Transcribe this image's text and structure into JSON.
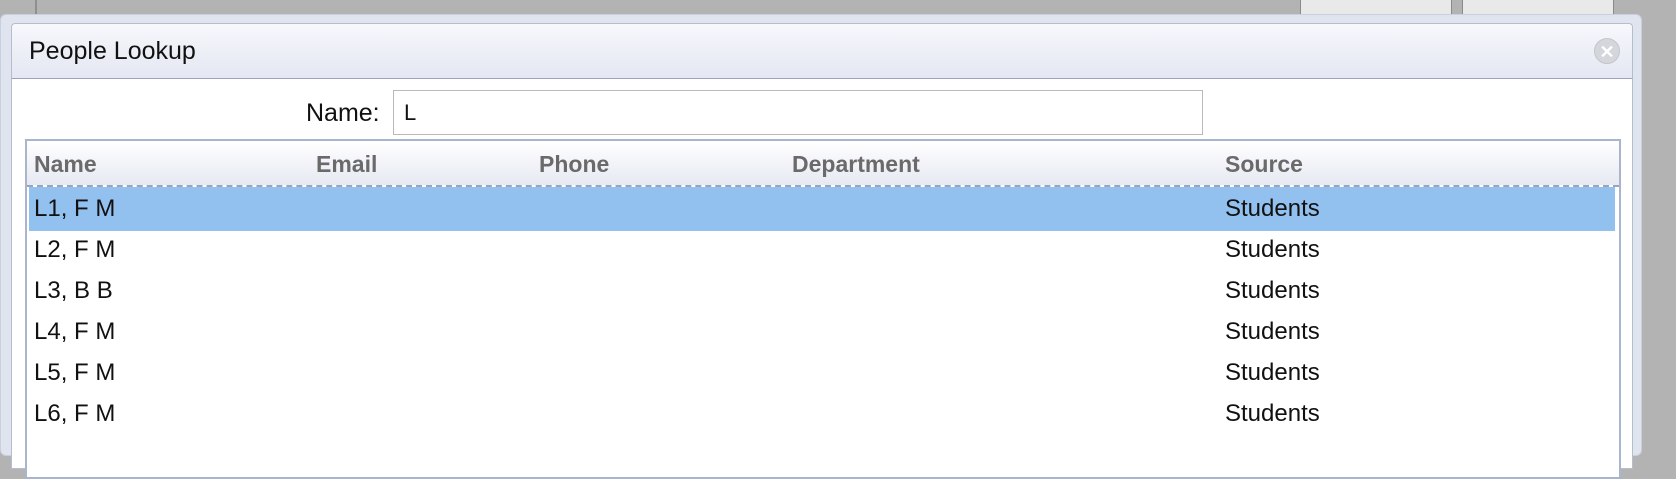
{
  "dialog": {
    "title": "People Lookup",
    "close_icon": "close-icon"
  },
  "search": {
    "label": "Name:",
    "value": "L"
  },
  "table": {
    "columns": [
      "Name",
      "Email",
      "Phone",
      "Department",
      "Source"
    ],
    "rows": [
      {
        "name": "L1, F M",
        "email": "",
        "phone": "",
        "department": "",
        "source": "Students",
        "selected": true
      },
      {
        "name": "L2, F M",
        "email": "",
        "phone": "",
        "department": "",
        "source": "Students",
        "selected": false
      },
      {
        "name": "L3, B B",
        "email": "",
        "phone": "",
        "department": "",
        "source": "Students",
        "selected": false
      },
      {
        "name": "L4, F M",
        "email": "",
        "phone": "",
        "department": "",
        "source": "Students",
        "selected": false
      },
      {
        "name": "L5, F M",
        "email": "",
        "phone": "",
        "department": "",
        "source": "Students",
        "selected": false
      },
      {
        "name": "L6, F M",
        "email": "",
        "phone": "",
        "department": "",
        "source": "Students",
        "selected": false
      }
    ]
  },
  "colors": {
    "selected_row": "#92c0ef",
    "header_text": "#6a6a6a"
  }
}
